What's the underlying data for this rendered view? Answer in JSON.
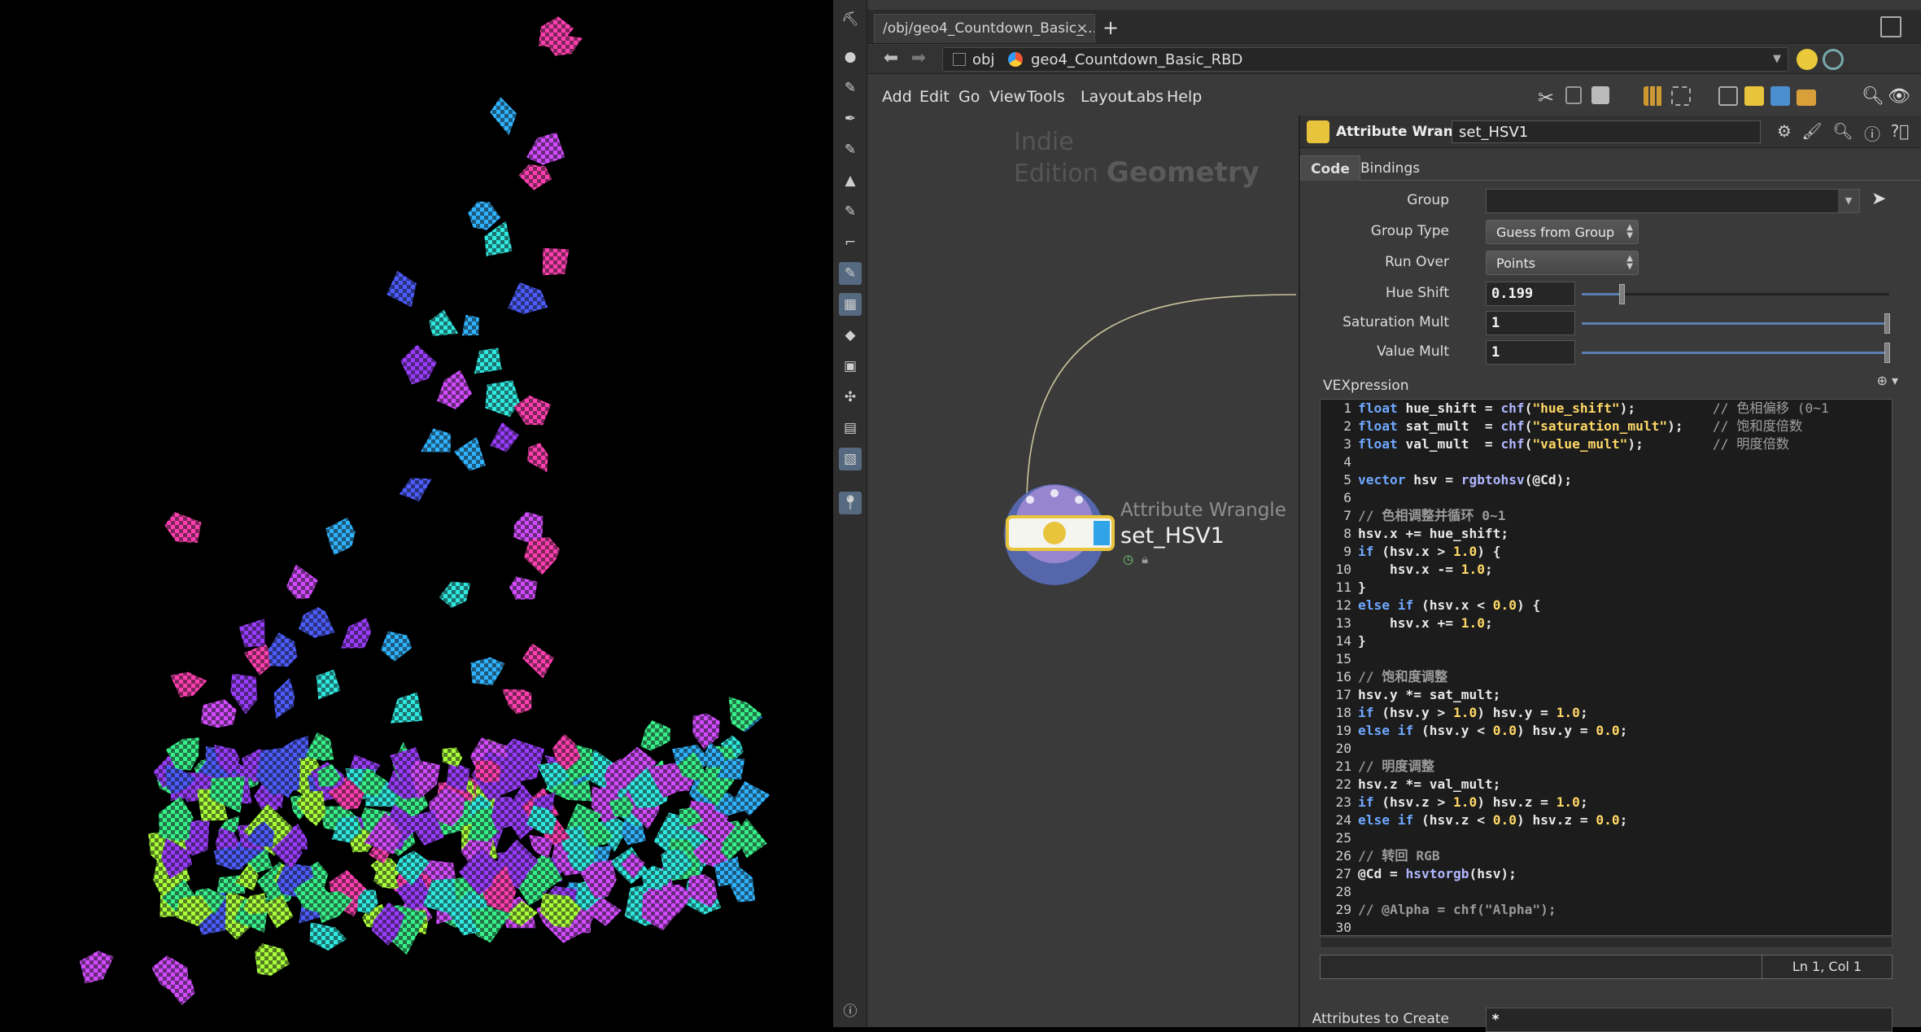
{
  "tabs": [
    {
      "label": "/obj/geo4_Countdown_Basic_...",
      "close": "×"
    }
  ],
  "tab_add": "+",
  "path": {
    "root": "obj",
    "node": "geo4_Countdown_Basic_RBD"
  },
  "menus": [
    "Add",
    "Edit",
    "Go",
    "View",
    "Tools",
    "Layout",
    "Labs",
    "Help"
  ],
  "network": {
    "edition": "Indie Edition",
    "context": "Geometry",
    "node": {
      "type_label": "Attribute Wrangle",
      "name": "set_HSV1"
    }
  },
  "params": {
    "node_type": "Attribute Wrangle",
    "node_name": "set_HSV1",
    "tabs": [
      "Code",
      "Bindings"
    ],
    "group_label": "Group",
    "group_value": "",
    "group_type_label": "Group Type",
    "group_type_value": "Guess from Group",
    "run_over_label": "Run Over",
    "run_over_value": "Points",
    "hue_shift_label": "Hue Shift",
    "hue_shift_value": "0.199",
    "hue_shift_fraction": 0.13,
    "sat_label": "Saturation Mult",
    "sat_value": "1",
    "val_label": "Value Mult",
    "val_value": "1",
    "vex_label": "VEXpression",
    "status": "Ln 1, Col 1",
    "attrs_label": "Attributes to Create",
    "attrs_value": "*"
  },
  "code_lines": [
    [
      {
        "t": "float",
        "c": "kw"
      },
      {
        "t": " hue_shift = "
      },
      {
        "t": "chf",
        "c": "fn"
      },
      {
        "t": "("
      },
      {
        "t": "\"hue_shift\"",
        "c": "str"
      },
      {
        "t": ");"
      },
      {
        "t": "// 色相偏移 (0~1",
        "c": "cmt-r"
      }
    ],
    [
      {
        "t": "float",
        "c": "kw"
      },
      {
        "t": " sat_mult  = "
      },
      {
        "t": "chf",
        "c": "fn"
      },
      {
        "t": "("
      },
      {
        "t": "\"saturation_mult\"",
        "c": "str"
      },
      {
        "t": ");"
      },
      {
        "t": "// 饱和度倍数",
        "c": "cmt-r"
      }
    ],
    [
      {
        "t": "float",
        "c": "kw"
      },
      {
        "t": " val_mult  = "
      },
      {
        "t": "chf",
        "c": "fn"
      },
      {
        "t": "("
      },
      {
        "t": "\"value_mult\"",
        "c": "str"
      },
      {
        "t": ");"
      },
      {
        "t": "// 明度倍数",
        "c": "cmt-r"
      }
    ],
    [],
    [
      {
        "t": "vector",
        "c": "kw"
      },
      {
        "t": " hsv = "
      },
      {
        "t": "rgbtohsv",
        "c": "fn"
      },
      {
        "t": "(@Cd);"
      }
    ],
    [],
    [
      {
        "t": "// 色相调整并循环 0~1",
        "c": "cmt"
      }
    ],
    [
      {
        "t": "hsv.x += hue_shift;"
      }
    ],
    [
      {
        "t": "if",
        "c": "kw"
      },
      {
        "t": " (hsv.x > "
      },
      {
        "t": "1.0",
        "c": "num"
      },
      {
        "t": ") {"
      }
    ],
    [
      {
        "t": "    hsv.x -= "
      },
      {
        "t": "1.0",
        "c": "num"
      },
      {
        "t": ";"
      }
    ],
    [
      {
        "t": "}"
      }
    ],
    [
      {
        "t": "else if",
        "c": "kw"
      },
      {
        "t": " (hsv.x < "
      },
      {
        "t": "0.0",
        "c": "num"
      },
      {
        "t": ") {"
      }
    ],
    [
      {
        "t": "    hsv.x += "
      },
      {
        "t": "1.0",
        "c": "num"
      },
      {
        "t": ";"
      }
    ],
    [
      {
        "t": "}"
      }
    ],
    [],
    [
      {
        "t": "// 饱和度调整",
        "c": "cmt"
      }
    ],
    [
      {
        "t": "hsv.y *= sat_mult;"
      }
    ],
    [
      {
        "t": "if",
        "c": "kw"
      },
      {
        "t": " (hsv.y > "
      },
      {
        "t": "1.0",
        "c": "num"
      },
      {
        "t": ") hsv.y = "
      },
      {
        "t": "1.0",
        "c": "num"
      },
      {
        "t": ";"
      }
    ],
    [
      {
        "t": "else if",
        "c": "kw"
      },
      {
        "t": " (hsv.y < "
      },
      {
        "t": "0.0",
        "c": "num"
      },
      {
        "t": ") hsv.y = "
      },
      {
        "t": "0.0",
        "c": "num"
      },
      {
        "t": ";"
      }
    ],
    [],
    [
      {
        "t": "// 明度调整",
        "c": "cmt"
      }
    ],
    [
      {
        "t": "hsv.z *= val_mult;"
      }
    ],
    [
      {
        "t": "if",
        "c": "kw"
      },
      {
        "t": " (hsv.z > "
      },
      {
        "t": "1.0",
        "c": "num"
      },
      {
        "t": ") hsv.z = "
      },
      {
        "t": "1.0",
        "c": "num"
      },
      {
        "t": ";"
      }
    ],
    [
      {
        "t": "else if",
        "c": "kw"
      },
      {
        "t": " (hsv.z < "
      },
      {
        "t": "0.0",
        "c": "num"
      },
      {
        "t": ") hsv.z = "
      },
      {
        "t": "0.0",
        "c": "num"
      },
      {
        "t": ";"
      }
    ],
    [],
    [
      {
        "t": "// 转回 RGB",
        "c": "cmt"
      }
    ],
    [
      {
        "t": "@Cd = "
      },
      {
        "t": "hsvtorgb",
        "c": "fn"
      },
      {
        "t": "(hsv);"
      }
    ],
    [],
    [
      {
        "t": "// @Alpha = chf(\"Alpha\");",
        "c": "cmt"
      }
    ],
    []
  ],
  "tool_icons": [
    "select-icon",
    "dot-icon",
    "brush-icon",
    "pen-icon",
    "paint-12-icon",
    "bucket-icon",
    "paint-12b-icon",
    "curve-icon",
    "sculpt-icon",
    "checker-icon",
    "diamond-icon",
    "landscape-icon",
    "compass-icon",
    "box-icon",
    "image-icon",
    "pin-icon",
    "info-icon"
  ],
  "colors": {
    "viewport_bg": "#000000",
    "accent": "#556a80",
    "node_yellow": "#e8c43c"
  }
}
